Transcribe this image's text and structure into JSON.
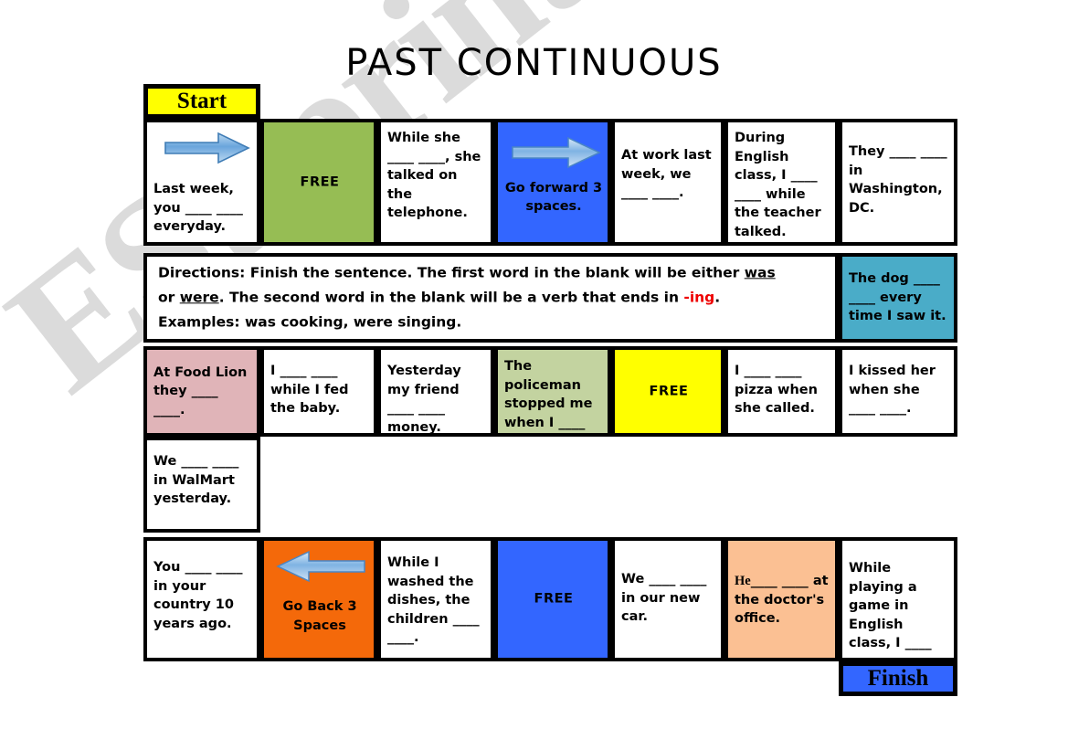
{
  "title": "PAST CONTINUOUS",
  "watermark": "ESLprintables.com",
  "start_label": "Start",
  "finish_label": "Finish",
  "directions": {
    "line1_a": "Directions:  Finish the sentence.   The first word in the blank will be either ",
    "line1_b": "was",
    "line2_a": "or ",
    "line2_b": "were",
    "line2_c": ".   The second word in the blank will be a verb that ends in ",
    "line2_d": "-ing",
    "line2_e": ".",
    "line3": "Examples:  was cooking, were singing."
  },
  "colors": {
    "green": "#96bd54",
    "blue": "#3366ff",
    "yellow": "#ffff00",
    "teal": "#4aacc8",
    "pink": "#e0b4b8",
    "light_green": "#c3d3a0",
    "orange": "#f4690a",
    "peach": "#fbc093",
    "white": "#ffffff",
    "red": "#ee0000",
    "border": "#000000",
    "arrow_blue": "#5b9bd5",
    "watermark_grey": "#cfcfcf"
  },
  "row1": [
    {
      "text": "Last week, you ____ ____ everyday.",
      "color": "white",
      "icon": "right-arrow-icon"
    },
    {
      "text": "FREE",
      "color": "green",
      "icon": ""
    },
    {
      "text": "While she ____ ____, she talked on the telephone.",
      "color": "white",
      "icon": ""
    },
    {
      "text": "Go forward 3 spaces.",
      "color": "blue",
      "icon": "right-arrow-icon"
    },
    {
      "text": "At work last week, we ____ ____.",
      "color": "white",
      "icon": ""
    },
    {
      "text": "During English class, I ____ ____ while the teacher talked.",
      "color": "white",
      "icon": ""
    },
    {
      "text": "They ____ ____ in Washington, DC.",
      "color": "white",
      "icon": ""
    }
  ],
  "row2_side": {
    "text": "The dog ____ ____ every time I saw it.",
    "color": "teal"
  },
  "row3": [
    {
      "text": "At Food Lion they ____ ____.",
      "color": "pink"
    },
    {
      "text": "I ____ ____ while I fed the baby.",
      "color": "white"
    },
    {
      "text": "Yesterday my friend ____ ____ money.",
      "color": "white"
    },
    {
      "text": "The policeman stopped me when I ____ ____.",
      "color": "light_green"
    },
    {
      "text": "FREE",
      "color": "yellow"
    },
    {
      "text": "I ____ ____ pizza when she called.",
      "color": "white"
    },
    {
      "text": "I kissed her when she ____ ____.",
      "color": "white"
    }
  ],
  "row4": [
    {
      "text": "We ____ ____ in WalMart yesterday.",
      "color": "white"
    }
  ],
  "row5": [
    {
      "text": "You ____ ____ in your country 10 years ago.",
      "color": "white",
      "icon": ""
    },
    {
      "text": "Go Back 3 Spaces",
      "color": "orange",
      "icon": "left-arrow-icon"
    },
    {
      "text": "While I washed the dishes, the children ____ ____.",
      "color": "white",
      "icon": ""
    },
    {
      "text": "FREE",
      "color": "blue",
      "icon": ""
    },
    {
      "text": "We ____ ____ in our new car.",
      "color": "white",
      "icon": ""
    },
    {
      "text": "He____ ____ at the doctor's office.",
      "color": "peach",
      "icon": ""
    },
    {
      "text": "While playing a game in English class, I ____ ____.",
      "color": "white",
      "icon": ""
    }
  ]
}
